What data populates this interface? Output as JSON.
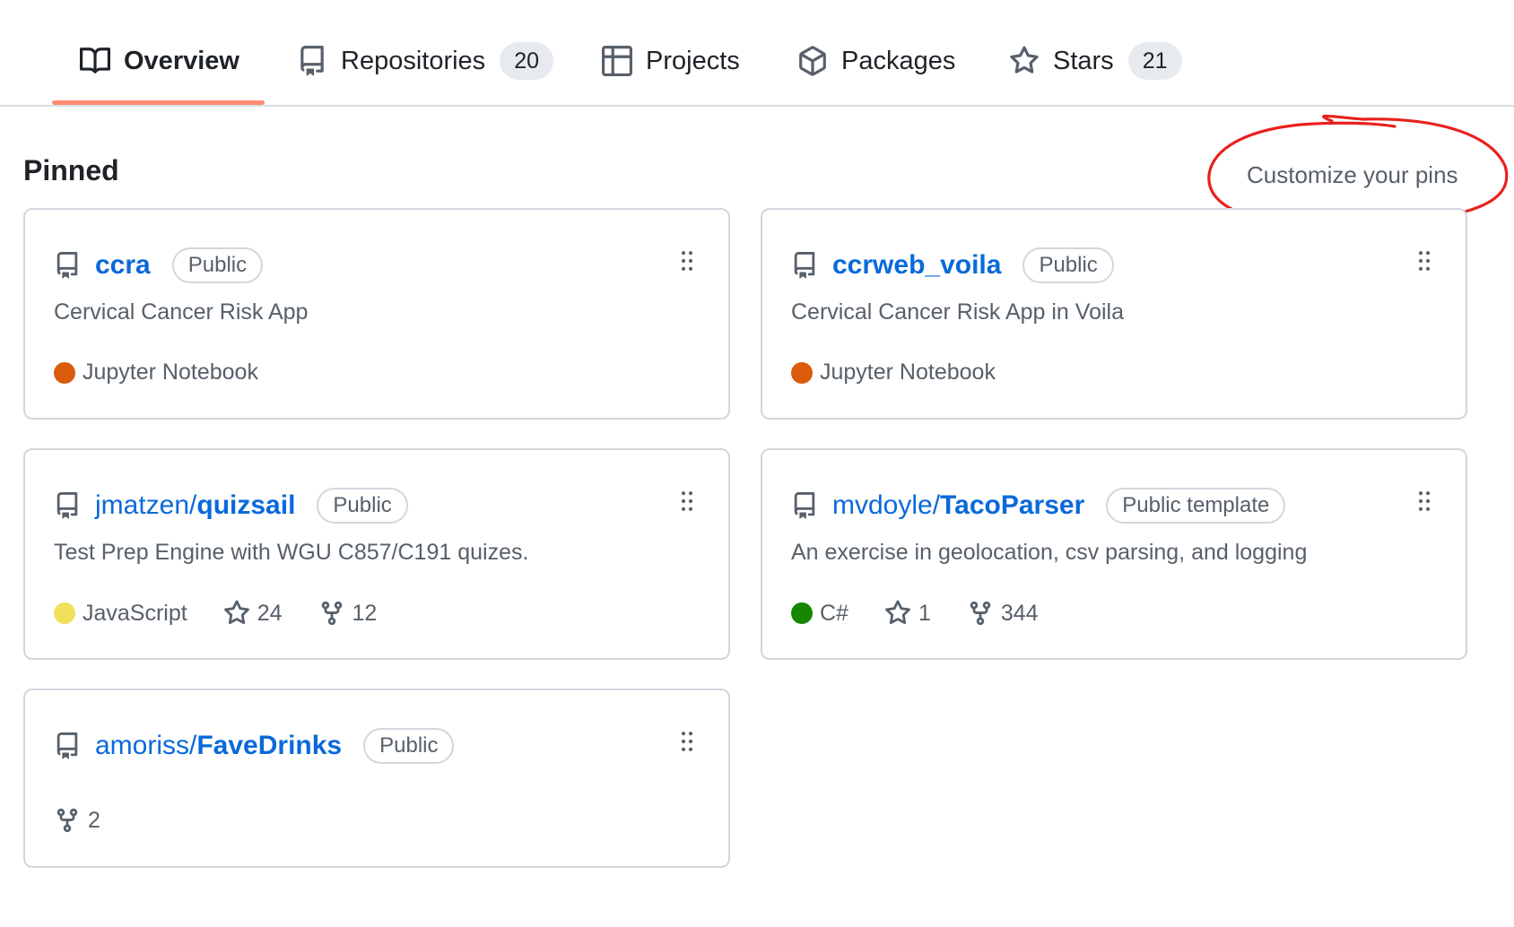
{
  "tabs": [
    {
      "label": "Overview",
      "icon": "book-icon",
      "active": true
    },
    {
      "label": "Repositories",
      "icon": "repo-icon",
      "count": "20"
    },
    {
      "label": "Projects",
      "icon": "table-icon"
    },
    {
      "label": "Packages",
      "icon": "package-icon"
    },
    {
      "label": "Stars",
      "icon": "star-icon",
      "count": "21"
    }
  ],
  "pinned": {
    "title": "Pinned",
    "customize_label": "Customize your pins",
    "annotation_color": "#e8211c",
    "cards": [
      {
        "owner": "",
        "name": "ccra",
        "visibility": "Public",
        "description": "Cervical Cancer Risk App",
        "language": "Jupyter Notebook",
        "language_color": "#DA5B0B"
      },
      {
        "owner": "",
        "name": "ccrweb_voila",
        "visibility": "Public",
        "description": "Cervical Cancer Risk App in Voila",
        "language": "Jupyter Notebook",
        "language_color": "#DA5B0B"
      },
      {
        "owner": "jmatzen/",
        "name": "quizsail",
        "visibility": "Public",
        "description": "Test Prep Engine with WGU C857/C191 quizes.",
        "language": "JavaScript",
        "language_color": "#f1e05a",
        "stars": "24",
        "forks": "12"
      },
      {
        "owner": "mvdoyle/",
        "name": "TacoParser",
        "visibility": "Public template",
        "description": "An exercise in geolocation, csv parsing, and logging",
        "language": "C#",
        "language_color": "#178600",
        "stars": "1",
        "forks": "344"
      },
      {
        "owner": "amoriss/",
        "name": "FaveDrinks",
        "visibility": "Public",
        "forks": "2"
      }
    ]
  },
  "colors": {
    "link": "#0969da",
    "muted": "#57606a",
    "border": "#d0d7de",
    "tab_underline": "#fd8c73"
  }
}
